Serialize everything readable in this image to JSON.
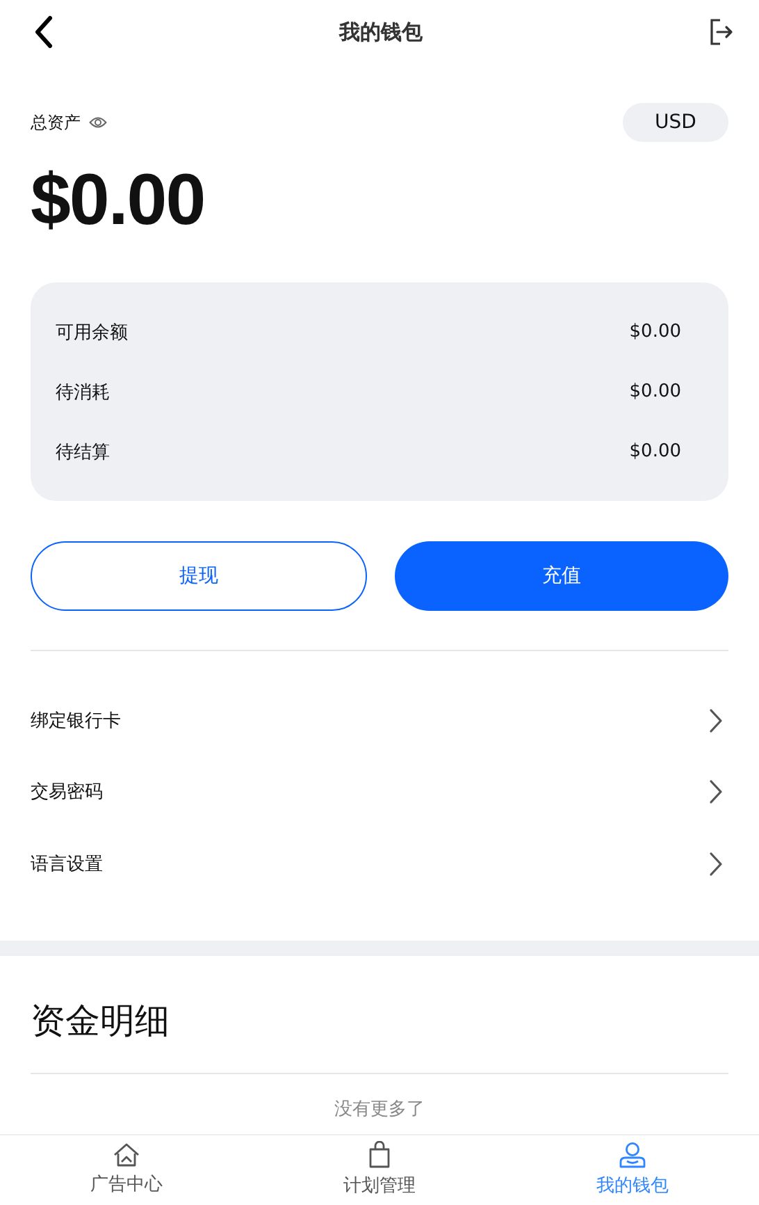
{
  "header": {
    "title": "我的钱包"
  },
  "assets": {
    "label": "总资产",
    "currency": "USD",
    "amount": "$0.00"
  },
  "balances": [
    {
      "label": "可用余额",
      "value": "$0.00"
    },
    {
      "label": "待消耗",
      "value": "$0.00"
    },
    {
      "label": "待结算",
      "value": "$0.00"
    }
  ],
  "actions": [
    {
      "label": "提现",
      "kind": "outline"
    },
    {
      "label": "充值",
      "kind": "filled"
    }
  ],
  "menu": [
    {
      "label": "绑定银行卡"
    },
    {
      "label": "交易密码"
    },
    {
      "label": "语言设置"
    }
  ],
  "details": {
    "title": "资金明细",
    "empty_text": "没有更多了"
  },
  "tabs": [
    {
      "label": "广告中心",
      "kind": "home",
      "selected": false
    },
    {
      "label": "计划管理",
      "kind": "bag",
      "selected": false
    },
    {
      "label": "我的钱包",
      "kind": "person",
      "selected": true
    }
  ]
}
